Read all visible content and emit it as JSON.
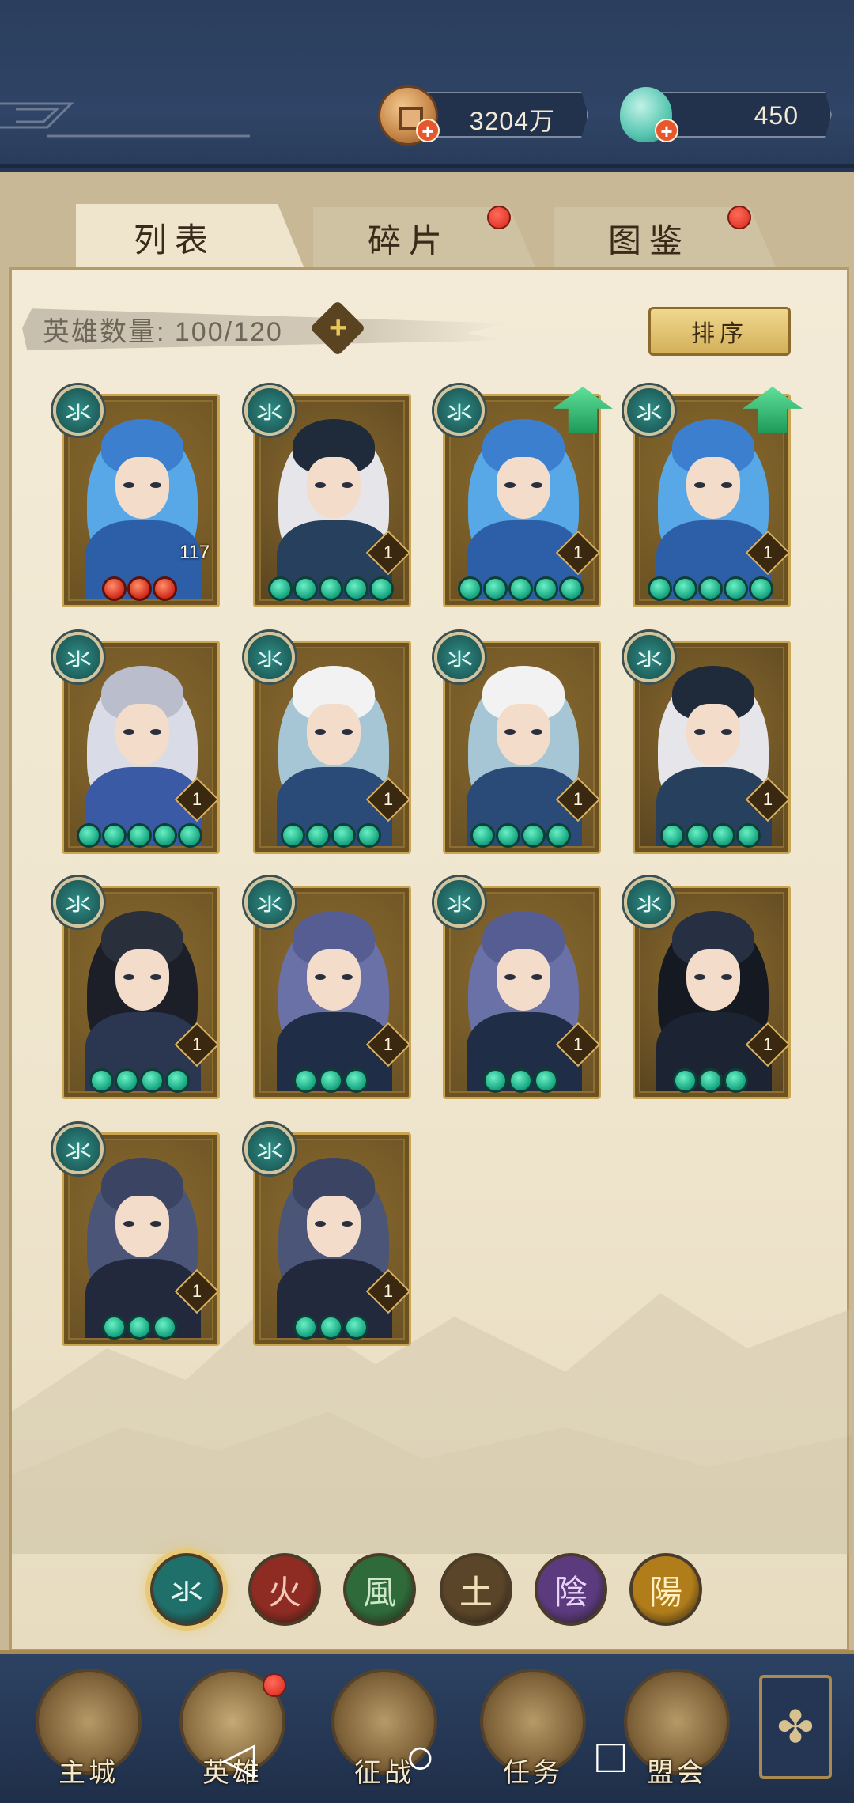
{
  "header": {
    "coins": {
      "value": "3204万",
      "icon": "coin-icon"
    },
    "jade": {
      "value": "450",
      "icon": "jade-icon"
    }
  },
  "tabs": [
    {
      "label": "列表",
      "active": true,
      "notification": false
    },
    {
      "label": "碎片",
      "active": false,
      "notification": true
    },
    {
      "label": "图鉴",
      "active": false,
      "notification": true
    }
  ],
  "hero_count": {
    "label": "英雄数量: 100/120"
  },
  "sort_button": {
    "label": "排序"
  },
  "heroes": [
    {
      "element": "氺",
      "level": "117",
      "stars": 3,
      "star_color": "red",
      "upgrade": false,
      "look": "blue-hair-woman"
    },
    {
      "element": "氺",
      "level": "1",
      "stars": 5,
      "star_color": "green",
      "upgrade": false,
      "look": "hat-masked"
    },
    {
      "element": "氺",
      "level": "1",
      "stars": 5,
      "star_color": "green",
      "upgrade": true,
      "look": "blue-hair-woman"
    },
    {
      "element": "氺",
      "level": "1",
      "stars": 5,
      "star_color": "green",
      "upgrade": true,
      "look": "blue-hair-woman"
    },
    {
      "element": "氺",
      "level": "1",
      "stars": 5,
      "star_color": "green",
      "upgrade": false,
      "look": "silver-hair-man"
    },
    {
      "element": "氺",
      "level": "1",
      "stars": 4,
      "star_color": "green",
      "upgrade": false,
      "look": "white-fur-man"
    },
    {
      "element": "氺",
      "level": "1",
      "stars": 4,
      "star_color": "green",
      "upgrade": false,
      "look": "white-fur-man"
    },
    {
      "element": "氺",
      "level": "1",
      "stars": 4,
      "star_color": "green",
      "upgrade": false,
      "look": "hat-masked"
    },
    {
      "element": "氺",
      "level": "1",
      "stars": 4,
      "star_color": "green",
      "upgrade": false,
      "look": "black-hair-scholar"
    },
    {
      "element": "氺",
      "level": "1",
      "stars": 3,
      "star_color": "green",
      "upgrade": false,
      "look": "spiky-hair-man"
    },
    {
      "element": "氺",
      "level": "1",
      "stars": 3,
      "star_color": "green",
      "upgrade": false,
      "look": "spiky-hair-man"
    },
    {
      "element": "氺",
      "level": "1",
      "stars": 3,
      "star_color": "green",
      "upgrade": false,
      "look": "hooded-ninja"
    },
    {
      "element": "氺",
      "level": "1",
      "stars": 3,
      "star_color": "green",
      "upgrade": false,
      "look": "armored-warrior"
    },
    {
      "element": "氺",
      "level": "1",
      "stars": 3,
      "star_color": "green",
      "upgrade": false,
      "look": "armored-warrior"
    }
  ],
  "element_filters": [
    {
      "glyph": "氺",
      "name": "water",
      "color": "#1f6f6a",
      "text_color": "#e6f6f2",
      "active": true
    },
    {
      "glyph": "火",
      "name": "fire",
      "color": "#8e2b22",
      "text_color": "#f3c8b8",
      "active": false
    },
    {
      "glyph": "風",
      "name": "wind",
      "color": "#2f6a3a",
      "text_color": "#cde8c8",
      "active": false
    },
    {
      "glyph": "土",
      "name": "earth",
      "color": "#5a4528",
      "text_color": "#efe0b8",
      "active": false
    },
    {
      "glyph": "陰",
      "name": "yin",
      "color": "#5b3a7e",
      "text_color": "#e8d4f6",
      "active": false
    },
    {
      "glyph": "陽",
      "name": "yang",
      "color": "#b07d1a",
      "text_color": "#fff0c0",
      "active": false
    }
  ],
  "bottom_nav": [
    {
      "label": "主城",
      "notification": false
    },
    {
      "label": "英雄",
      "notification": true
    },
    {
      "label": "征战",
      "notification": false
    },
    {
      "label": "任务",
      "notification": false
    },
    {
      "label": "盟会",
      "notification": false
    }
  ],
  "system_nav": {
    "back": "◁",
    "home": "○",
    "recents": "□"
  }
}
